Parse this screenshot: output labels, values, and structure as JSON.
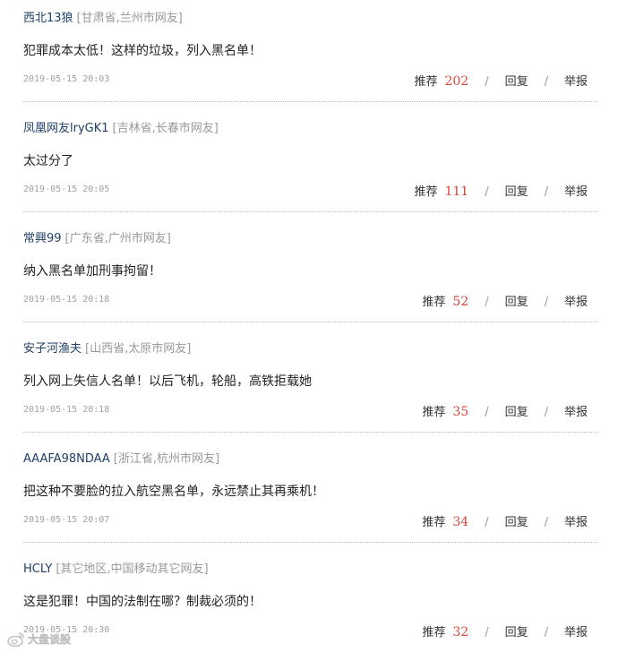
{
  "comments": [
    {
      "username": "西北13狼",
      "location": "[甘肃省,兰州市网友]",
      "text": "犯罪成本太低！这样的垃圾，列入黑名单！",
      "time": "2019-05-15 20:03",
      "recommend_label": "推荐",
      "votes": "202",
      "reply_label": "回复",
      "report_label": "举报",
      "separator": "/"
    },
    {
      "username": "凤凰网友lryGK1",
      "location": "[吉林省,长春市网友]",
      "text": "太过分了",
      "time": "2019-05-15 20:05",
      "recommend_label": "推荐",
      "votes": "111",
      "reply_label": "回复",
      "report_label": "举报",
      "separator": "/"
    },
    {
      "username": "常興99",
      "location": "[广东省,广州市网友]",
      "text": "纳入黑名单加刑事拘留！",
      "time": "2019-05-15 20:18",
      "recommend_label": "推荐",
      "votes": "52",
      "reply_label": "回复",
      "report_label": "举报",
      "separator": "/"
    },
    {
      "username": "安子河渔夫",
      "location": "[山西省,太原市网友]",
      "text": "列入网上失信人名单！以后飞机，轮船，高铁拒载她",
      "time": "2019-05-15 20:18",
      "recommend_label": "推荐",
      "votes": "35",
      "reply_label": "回复",
      "report_label": "举报",
      "separator": "/"
    },
    {
      "username": "AAAFA98NDAA",
      "location": "[浙江省,杭州市网友]",
      "text": "把这种不要脸的拉入航空黑名单，永远禁止其再乘机！",
      "time": "2019-05-15 20:07",
      "recommend_label": "推荐",
      "votes": "34",
      "reply_label": "回复",
      "report_label": "举报",
      "separator": "/"
    },
    {
      "username": "HCLY",
      "location": "[其它地区,中国移动其它网友]",
      "text": "这是犯罪！中国的法制在哪？制裁必须的！",
      "time": "2019-05-15 20:30",
      "recommend_label": "推荐",
      "votes": "32",
      "reply_label": "回复",
      "report_label": "举报",
      "separator": "/"
    }
  ],
  "watermark": {
    "text": "大盘谈股",
    "icon": "weibo-logo-icon"
  },
  "colors": {
    "username": "#1f3f66",
    "location": "#999999",
    "votes": "#d9453b",
    "timestamp": "#a0a0a0"
  }
}
